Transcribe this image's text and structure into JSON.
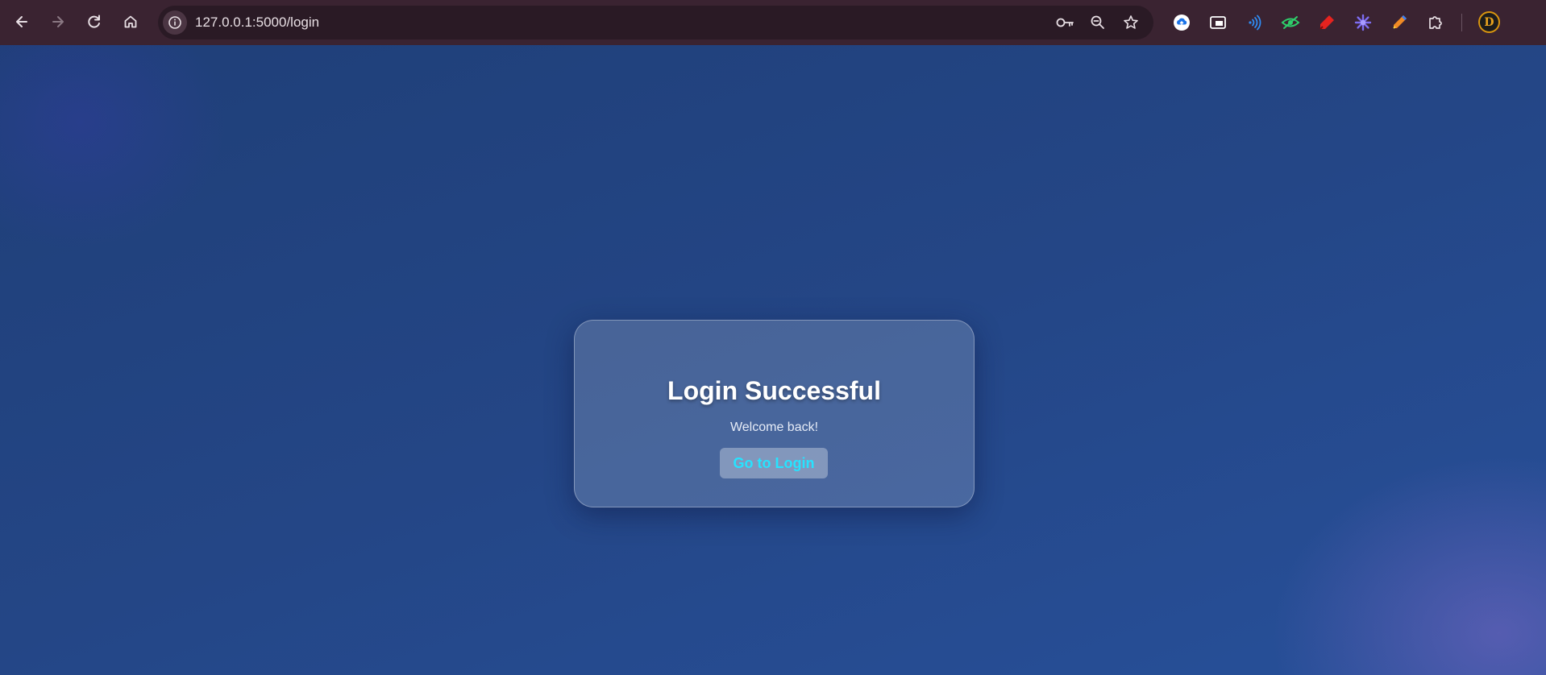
{
  "browser": {
    "url": "127.0.0.1:5000/login",
    "nav_icons": [
      "back-arrow-icon",
      "forward-arrow-icon",
      "reload-icon",
      "home-icon"
    ],
    "omnibox_icons": [
      "site-info-icon",
      "password-key-icon",
      "zoom-out-icon",
      "bookmark-star-icon"
    ],
    "extension_icons": [
      "cloud-upload-icon",
      "picture-in-picture-icon",
      "wifi-signal-icon",
      "eye-icon",
      "marker-pen-icon",
      "sparkle-flower-icon",
      "color-pen-icon",
      "puzzle-extensions-icon"
    ],
    "profile_initial": "D",
    "colors": {
      "toolbar": "#3a2331",
      "omnibox": "#2a1a25"
    }
  },
  "page": {
    "title": "Login Successful",
    "message": "Welcome back!",
    "button_label": "Go to Login",
    "colors": {
      "background": "#234785",
      "button_text": "#26e3ff",
      "title_text": "#ffffff"
    }
  }
}
